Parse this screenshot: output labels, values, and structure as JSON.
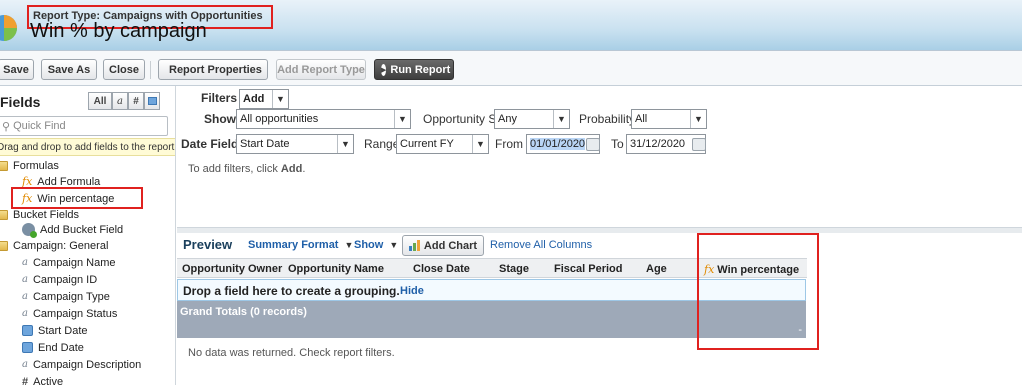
{
  "header": {
    "report_type_label": "Report Type: Campaigns with Opportunities",
    "title": "Win % by campaign"
  },
  "toolbar": {
    "save": "Save",
    "save_as": "Save As",
    "close": "Close",
    "report_properties": "Report Properties",
    "add_report_type": "Add Report Type",
    "run_report": "Run Report"
  },
  "fields_panel": {
    "heading": "Fields",
    "filter_all": "All",
    "filter_text": "a",
    "filter_number": "#",
    "quick_find_placeholder": "Quick Find",
    "drag_hint": "Drag and drop to add fields to the report.",
    "tree": {
      "formulas": "Formulas",
      "add_formula": "Add Formula",
      "win_percentage": "Win percentage",
      "bucket_fields": "Bucket Fields",
      "add_bucket_field": "Add Bucket Field",
      "campaign_general": "Campaign: General",
      "items": [
        "Campaign Name",
        "Campaign ID",
        "Campaign Type",
        "Campaign Status",
        "Start Date",
        "End Date",
        "Campaign Description",
        "Active"
      ]
    }
  },
  "filters": {
    "label": "Filters",
    "add_button": "Add",
    "show_label": "Show",
    "show_value": "All opportunities",
    "opp_status_label": "Opportunity Status",
    "opp_status_value": "Any",
    "probability_label": "Probability",
    "probability_value": "All",
    "date_field_label": "Date Field",
    "date_field_value": "Start Date",
    "range_label": "Range",
    "range_value": "Current FY",
    "from_label": "From",
    "from_value": "01/01/2020",
    "to_label": "To",
    "to_value": "31/12/2020",
    "hint_prefix": "To add filters, click ",
    "hint_bold": "Add",
    "hint_suffix": "."
  },
  "preview": {
    "title": "Preview",
    "summary_format": "Summary Format",
    "show": "Show",
    "add_chart": "Add Chart",
    "remove_all_columns": "Remove All Columns",
    "columns": [
      "Opportunity Owner",
      "Opportunity Name",
      "Close Date",
      "Stage",
      "Fiscal Period",
      "Age",
      "Win percentage"
    ],
    "group_hint": "Drop a field here to create a grouping.",
    "hide": "Hide",
    "grand_totals": "Grand Totals (0 records)",
    "totals_dash": "-",
    "no_data": "No data was returned. Check report filters."
  },
  "colors": {
    "highlight": "#e0211f",
    "link": "#1f5fa8",
    "totals_bg": "#9ea9b8"
  }
}
